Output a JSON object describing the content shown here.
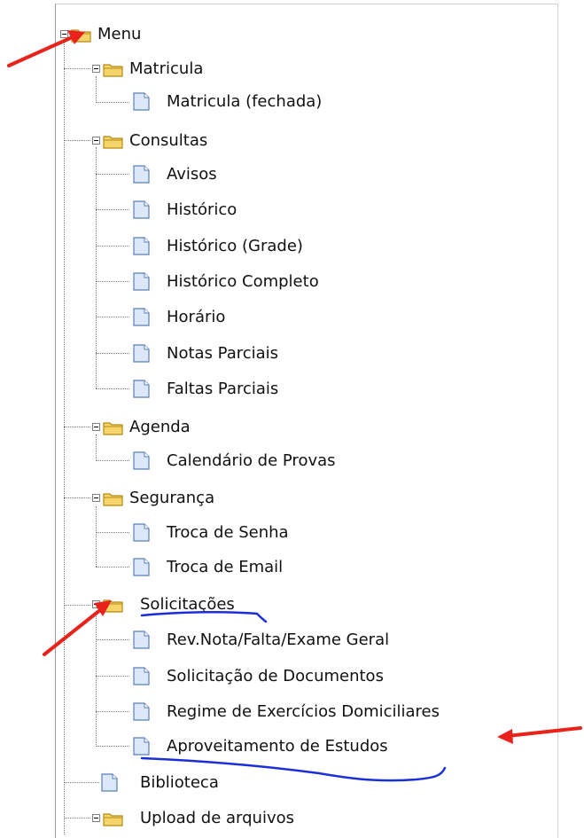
{
  "tree": {
    "root": {
      "label": "Menu"
    },
    "matricula": {
      "label": "Matricula",
      "items": [
        "Matricula (fechada)"
      ]
    },
    "consultas": {
      "label": "Consultas",
      "items": [
        "Avisos",
        "Histórico",
        "Histórico (Grade)",
        "Histórico Completo",
        "Horário",
        "Notas Parciais",
        "Faltas Parciais"
      ]
    },
    "agenda": {
      "label": "Agenda",
      "items": [
        "Calendário de Provas"
      ]
    },
    "seguranca": {
      "label": "Segurança",
      "items": [
        "Troca de Senha",
        "Troca de Email"
      ]
    },
    "solicitacoes": {
      "label": "Solicitações",
      "items": [
        "Rev.Nota/Falta/Exame Geral",
        "Solicitação de Documentos",
        "Regime de Exercícios Domiciliares",
        "Aproveitamento de Estudos"
      ]
    },
    "biblioteca": {
      "label": "Biblioteca"
    },
    "upload": {
      "label": "Upload de arquivos"
    }
  },
  "colors": {
    "annotation_arrow": "#e8231c",
    "annotation_underline": "#1a2fd6",
    "folder_fill": "#f5d46a",
    "folder_stroke": "#b58a16",
    "page_fill": "#dce8f8",
    "page_stroke": "#5a7fb5"
  },
  "icons": {
    "folder": "folder-icon",
    "page": "page-icon",
    "collapse": "collapse-toggle-icon"
  }
}
